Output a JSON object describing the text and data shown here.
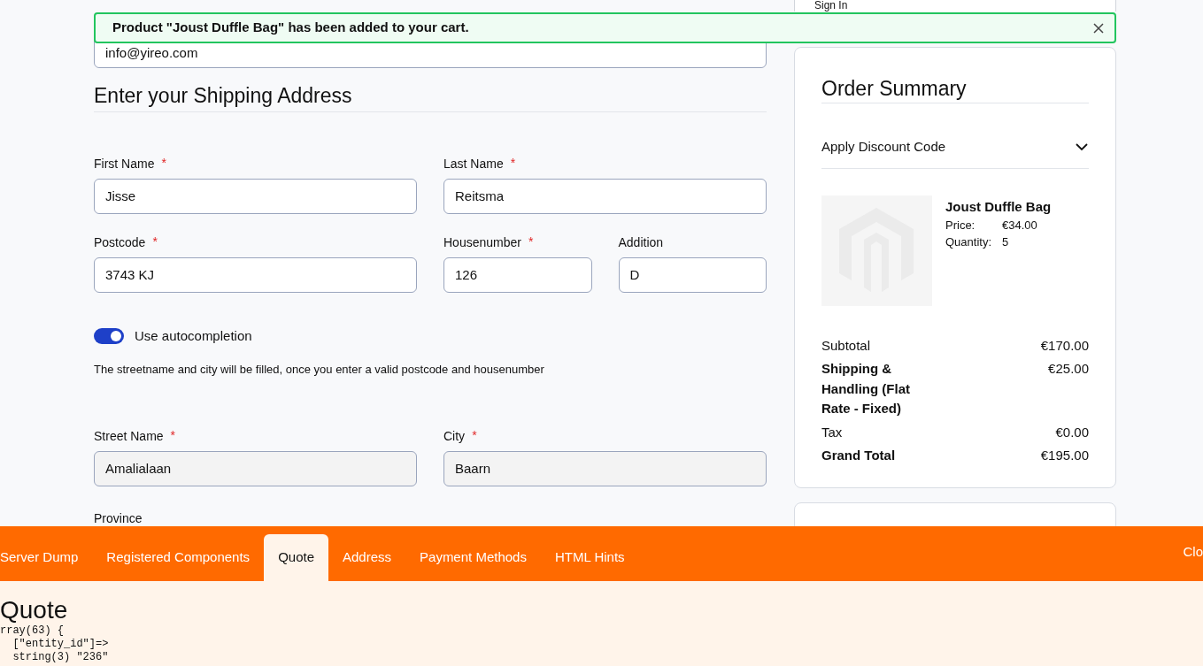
{
  "header": {
    "sign_in": "Sign In"
  },
  "toast": {
    "message": "Product \"Joust Duffle Bag\" has been added to your cart."
  },
  "email_field": {
    "value": "info@yireo.com"
  },
  "shipping": {
    "title": "Enter your Shipping Address",
    "rows": [
      [
        {
          "label": "First Name",
          "value": "Jisse",
          "required_mark": "*",
          "disabled": false
        },
        {
          "label": "Last Name",
          "value": "Reitsma",
          "required_mark": "*",
          "disabled": false
        }
      ],
      [
        {
          "label": "Postcode",
          "value": "3743 KJ",
          "required_mark": "*",
          "disabled": false
        },
        {
          "label": "Housenumber",
          "value": "126",
          "required_mark": "*",
          "disabled": false
        },
        {
          "label": "Addition",
          "value": "D",
          "disabled": false
        }
      ]
    ],
    "autocomplete": {
      "label": "Use autocompletion",
      "on": true
    },
    "hint": "The streetname and city will be filled, once you enter a valid postcode and housenumber",
    "rows_after": [
      [
        {
          "label": "Street Name",
          "value": "Amalialaan",
          "required_mark": "*",
          "disabled": true
        },
        {
          "label": "City",
          "value": "Baarn",
          "required_mark": "*",
          "disabled": true
        }
      ]
    ],
    "province_label": "Province"
  },
  "order_summary": {
    "title": "Order Summary",
    "discount": {
      "label": "Apply Discount Code",
      "expanded": false
    },
    "product": {
      "name": "Joust Duffle Bag",
      "price_label": "Price:",
      "price": "€34.00",
      "quantity_label": "Quantity:",
      "quantity": "5"
    },
    "totals": [
      {
        "label": "Subtotal",
        "value": "€170.00",
        "bold": false
      },
      {
        "label": "Shipping & Handling (Flat Rate - Fixed)",
        "value": "€25.00",
        "bold": true
      },
      {
        "label": "Tax",
        "value": "€0.00",
        "bold": false
      },
      {
        "label": "Grand Total",
        "value": "€195.00",
        "bold": true
      }
    ]
  },
  "dev_panel": {
    "tabs": [
      {
        "label": "Server Dump",
        "selected": false
      },
      {
        "label": "Registered Components",
        "selected": false
      },
      {
        "label": "Quote",
        "selected": true
      },
      {
        "label": "Address",
        "selected": false
      },
      {
        "label": "Payment Methods",
        "selected": false
      },
      {
        "label": "HTML Hints",
        "selected": false
      }
    ],
    "close_label": "Clo",
    "heading": "Quote",
    "code_lines": [
      "rray(63) {",
      "  [\"entity_id\"]=>",
      "  string(3) \"236\""
    ]
  }
}
